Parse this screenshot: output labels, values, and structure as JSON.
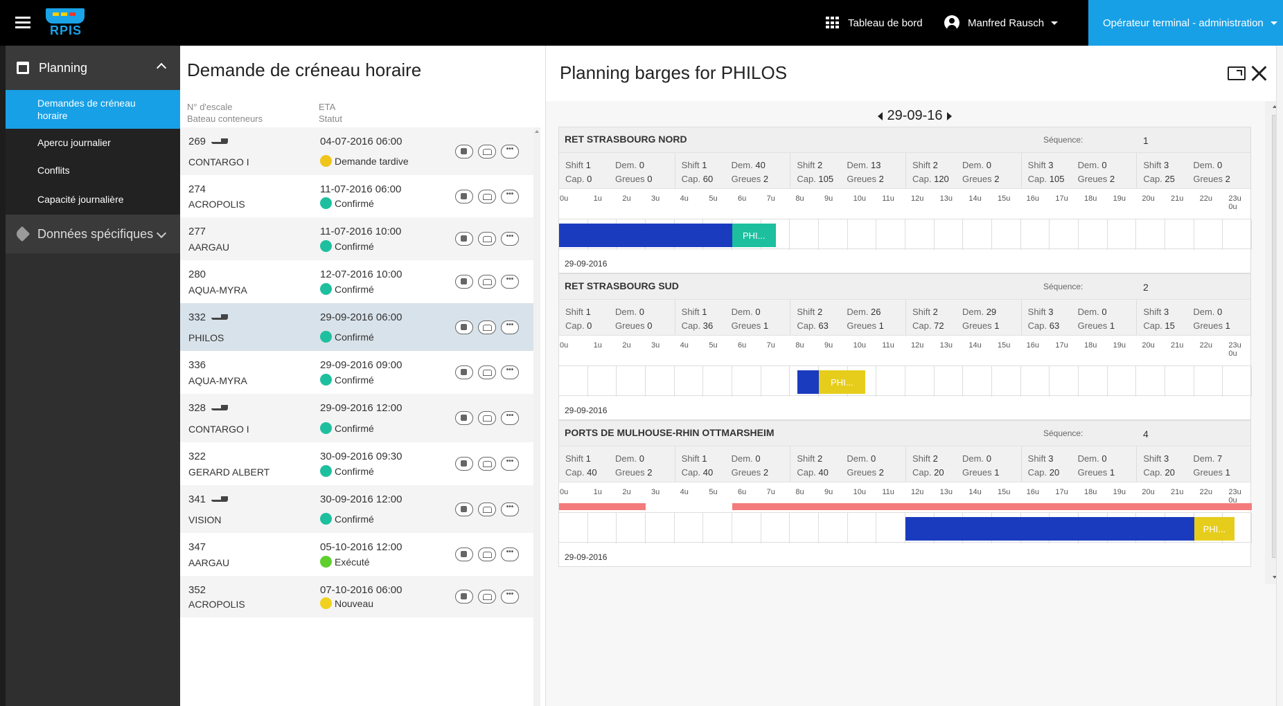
{
  "app": {
    "logo_text": "RPIS"
  },
  "topbar": {
    "dashboard_label": "Tableau de bord",
    "user_name": "Manfred Rausch",
    "role_label": "Opérateur terminal - administration"
  },
  "sidebar": {
    "planning_label": "Planning",
    "items": [
      {
        "label": "Demandes de créneau horaire",
        "active": true
      },
      {
        "label": "Apercu journalier"
      },
      {
        "label": "Conflits"
      },
      {
        "label": "Capacité journalière"
      }
    ],
    "specific_label": "Données spécifiques"
  },
  "list": {
    "title": "Demande de créneau horaire",
    "col1_line1": "N° d'escale",
    "col1_line2": "Bateau conteneurs",
    "col2_line1": "ETA",
    "col2_line2": "Statut",
    "rows": [
      {
        "num": "269",
        "boat": true,
        "name": "CONTARGO I",
        "eta": "04-07-2016 06:00",
        "status": "Demande tardive",
        "color": "#f0c419"
      },
      {
        "num": "274",
        "boat": false,
        "name": "ACROPOLIS",
        "eta": "11-07-2016 06:00",
        "status": "Confirmé",
        "color": "#1dbf9f"
      },
      {
        "num": "277",
        "boat": false,
        "name": "AARGAU",
        "eta": "11-07-2016 10:00",
        "status": "Confirmé",
        "color": "#1dbf9f"
      },
      {
        "num": "280",
        "boat": false,
        "name": "AQUA-MYRA",
        "eta": "12-07-2016 10:00",
        "status": "Confirmé",
        "color": "#1dbf9f"
      },
      {
        "num": "332",
        "boat": true,
        "name": "PHILOS",
        "eta": "29-09-2016 06:00",
        "status": "Confirmé",
        "color": "#1dbf9f",
        "selected": true
      },
      {
        "num": "336",
        "boat": false,
        "name": "AQUA-MYRA",
        "eta": "29-09-2016 09:00",
        "status": "Confirmé",
        "color": "#1dbf9f"
      },
      {
        "num": "328",
        "boat": true,
        "name": "CONTARGO I",
        "eta": "29-09-2016 12:00",
        "status": "Confirmé",
        "color": "#1dbf9f"
      },
      {
        "num": "322",
        "boat": false,
        "name": "GERARD ALBERT",
        "eta": "30-09-2016 09:30",
        "status": "Confirmé",
        "color": "#1dbf9f"
      },
      {
        "num": "341",
        "boat": true,
        "name": "VISION",
        "eta": "30-09-2016 12:00",
        "status": "Confirmé",
        "color": "#1dbf9f"
      },
      {
        "num": "347",
        "boat": false,
        "name": "AARGAU",
        "eta": "05-10-2016 12:00",
        "status": "Exécuté",
        "color": "#5fcf2e"
      },
      {
        "num": "352",
        "boat": false,
        "name": "ACROPOLIS",
        "eta": "07-10-2016 06:00",
        "status": "Nouveau",
        "color": "#f0d21e"
      }
    ]
  },
  "detail": {
    "title": "Planning barges for PHILOS",
    "date": "29-09-16",
    "hours": [
      "0u",
      "1u",
      "2u",
      "3u",
      "4u",
      "5u",
      "6u",
      "7u",
      "8u",
      "9u",
      "10u",
      "11u",
      "12u",
      "13u",
      "14u",
      "15u",
      "16u",
      "17u",
      "18u",
      "19u",
      "20u",
      "21u",
      "22u",
      "23u 0u"
    ],
    "labels": {
      "shift": "Shift",
      "dem": "Dem.",
      "cap": "Cap.",
      "greues": "Greues",
      "sequence": "Séquence:"
    },
    "terminals": [
      {
        "name": "RET STRASBOURG NORD",
        "sequence": "1",
        "date": "29-09-2016",
        "shifts": [
          {
            "shift": "1",
            "dem": "0",
            "cap": "0",
            "greues": "0"
          },
          {
            "shift": "1",
            "dem": "40",
            "cap": "60",
            "greues": "2"
          },
          {
            "shift": "2",
            "dem": "13",
            "cap": "105",
            "greues": "2"
          },
          {
            "shift": "2",
            "dem": "0",
            "cap": "120",
            "greues": "2"
          },
          {
            "shift": "3",
            "dem": "0",
            "cap": "105",
            "greues": "2"
          },
          {
            "shift": "3",
            "dem": "0",
            "cap": "25",
            "greues": "2"
          }
        ],
        "bars": [
          {
            "start": 0,
            "end": 6,
            "color": "#1b3bbf",
            "label": ""
          },
          {
            "start": 6,
            "end": 7.5,
            "color": "#1dbf9f",
            "label": "PHI..."
          }
        ],
        "closures": []
      },
      {
        "name": "RET STRASBOURG SUD",
        "sequence": "2",
        "date": "29-09-2016",
        "shifts": [
          {
            "shift": "1",
            "dem": "0",
            "cap": "0",
            "greues": "0"
          },
          {
            "shift": "1",
            "dem": "0",
            "cap": "36",
            "greues": "1"
          },
          {
            "shift": "2",
            "dem": "26",
            "cap": "63",
            "greues": "1"
          },
          {
            "shift": "2",
            "dem": "29",
            "cap": "72",
            "greues": "1"
          },
          {
            "shift": "3",
            "dem": "0",
            "cap": "63",
            "greues": "1"
          },
          {
            "shift": "3",
            "dem": "0",
            "cap": "15",
            "greues": "1"
          }
        ],
        "bars": [
          {
            "start": 8.25,
            "end": 9,
            "color": "#1b3bbf",
            "label": ""
          },
          {
            "start": 9,
            "end": 10.6,
            "color": "#e6cd1c",
            "label": "PHI..."
          }
        ],
        "closures": []
      },
      {
        "name": "PORTS DE MULHOUSE-RHIN OTTMARSHEIM",
        "sequence": "4",
        "date": "29-09-2016",
        "shifts": [
          {
            "shift": "1",
            "dem": "0",
            "cap": "40",
            "greues": "2"
          },
          {
            "shift": "1",
            "dem": "0",
            "cap": "40",
            "greues": "2"
          },
          {
            "shift": "2",
            "dem": "0",
            "cap": "40",
            "greues": "2"
          },
          {
            "shift": "2",
            "dem": "0",
            "cap": "20",
            "greues": "1"
          },
          {
            "shift": "3",
            "dem": "0",
            "cap": "20",
            "greues": "1"
          },
          {
            "shift": "3",
            "dem": "7",
            "cap": "20",
            "greues": "1"
          }
        ],
        "bars": [
          {
            "start": 12,
            "end": 22,
            "color": "#1b3bbf",
            "label": ""
          },
          {
            "start": 22,
            "end": 23.4,
            "color": "#e6cd1c",
            "label": "PHI..."
          }
        ],
        "closures": [
          {
            "start": 0,
            "end": 3
          },
          {
            "start": 6,
            "end": 24
          }
        ]
      }
    ]
  }
}
